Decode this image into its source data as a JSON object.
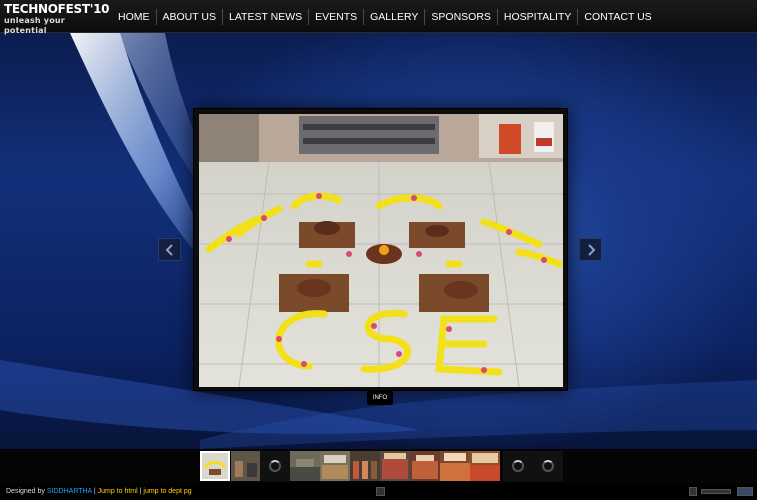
{
  "logo": {
    "title": "TECHNOFEST'10",
    "tagline": "unleash your potential"
  },
  "nav": [
    "HOME",
    "ABOUT US",
    "LATEST NEWS",
    "EVENTS",
    "GALLERY",
    "SPONSORS",
    "HOSPITALITY",
    "CONTACT US"
  ],
  "viewer": {
    "info_label": "INFO",
    "photo_text": "CSE"
  },
  "footer": {
    "designed_by": "Designed by",
    "designer": "SIDDHARTHA",
    "sep1": " | ",
    "link_home": "Jump to html",
    "sep2": " | ",
    "link_dept": "jump to dept pg"
  },
  "colors": {
    "accent_link": "#ffd400",
    "designer": "#1ea8ff",
    "flower_yellow": "#f2e11a",
    "flower_pink": "#d9487a"
  }
}
